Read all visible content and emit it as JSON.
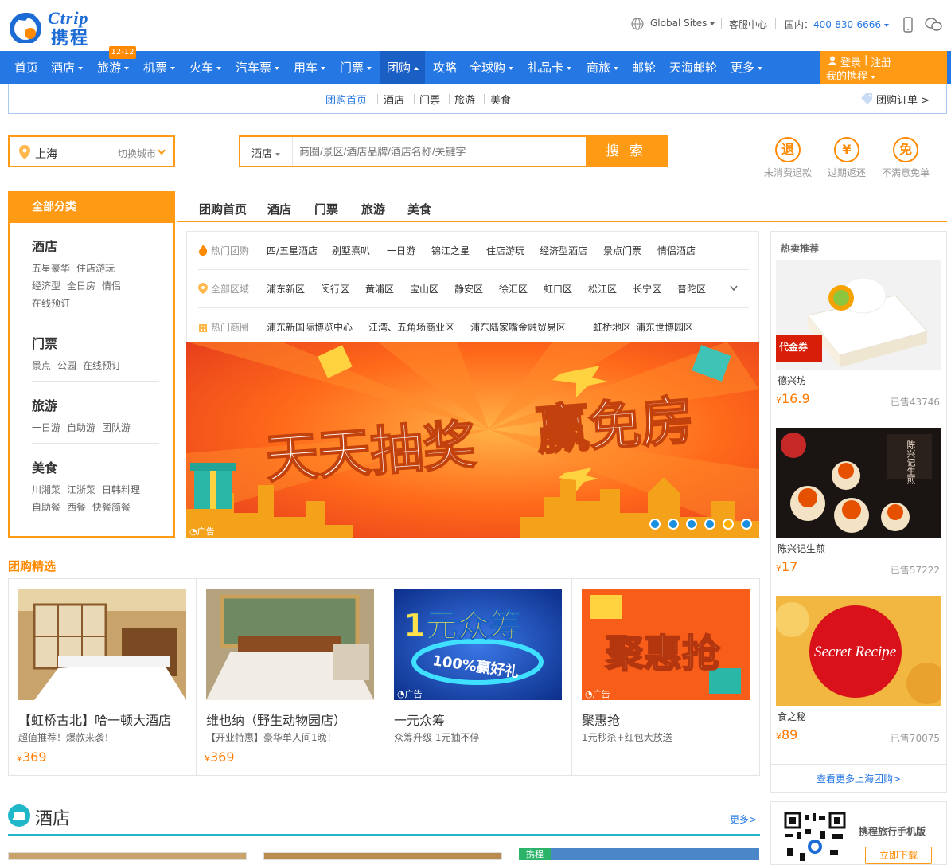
{
  "brand": {
    "latin": "Ctrip",
    "cn": "携程"
  },
  "topbar": {
    "global_sites": "Global Sites",
    "service": "客服中心",
    "phone_label": "国内：",
    "phone": "400-830-6666"
  },
  "nav": {
    "items": [
      "首页",
      "酒店",
      "旅游",
      "机票",
      "火车",
      "汽车票",
      "用车",
      "门票",
      "团购",
      "攻略",
      "全球购",
      "礼品卡",
      "商旅",
      "邮轮",
      "天海邮轮",
      "更多"
    ],
    "badge": "12-12",
    "login": "登录",
    "register": "注册",
    "my": "我的携程"
  },
  "subnav": {
    "items": [
      "团购首页",
      "酒店",
      "门票",
      "旅游",
      "美食"
    ],
    "orders": "团购订单 >"
  },
  "search": {
    "city": "上海",
    "switch_city": "切换城市",
    "type": "酒店",
    "placeholder": "商圈/景区/酒店品牌/酒店名称/关键字",
    "button": "搜 索"
  },
  "promises": [
    {
      "icon": "退",
      "label": "未消费退款"
    },
    {
      "icon": "¥",
      "label": "过期返还"
    },
    {
      "icon": "免",
      "label": "不满意免单"
    }
  ],
  "categories": {
    "head": "全部分类",
    "groups": [
      {
        "title": "酒店",
        "links": [
          "五星豪华",
          "住店游玩",
          "经济型",
          "全日房",
          "情侣",
          "在线预订"
        ]
      },
      {
        "title": "门票",
        "links": [
          "景点",
          "公园",
          "在线预订"
        ]
      },
      {
        "title": "旅游",
        "links": [
          "一日游",
          "自助游",
          "团队游"
        ]
      },
      {
        "title": "美食",
        "links": [
          "川湘菜",
          "江浙菜",
          "日韩料理",
          "自助餐",
          "西餐",
          "快餐简餐"
        ]
      }
    ]
  },
  "tabs": [
    "团购首页",
    "酒店",
    "门票",
    "旅游",
    "美食"
  ],
  "filters": {
    "hot_label": "热门团购",
    "hot": [
      "四/五星酒店",
      "别墅熹叭",
      "一日游",
      "锦江之星",
      "住店游玩",
      "经济型酒店",
      "景点门票",
      "情侣酒店"
    ],
    "area_label": "全部区域",
    "areas": [
      "浦东新区",
      "闵行区",
      "黄浦区",
      "宝山区",
      "静安区",
      "徐汇区",
      "虹口区",
      "松江区",
      "长宁区",
      "普陀区"
    ],
    "biz_label": "热门商圈",
    "biz": [
      "浦东新国际博览中心",
      "江湾、五角场商业区",
      "浦东陆家嘴金融贸易区",
      "虹桥地区",
      "浦东世博园区"
    ]
  },
  "banner": {
    "text1": "天天抽奖",
    "text2": "赢免房",
    "ad": "广告"
  },
  "hot": {
    "title": "热卖推荐",
    "items": [
      {
        "name": "德兴坊",
        "price": "16.9",
        "sold": "已售43746",
        "tag": "代金券"
      },
      {
        "name": "陈兴记生煎",
        "price": "17",
        "sold": "已售57222",
        "tag": "陈兴记生煎"
      },
      {
        "name": "食之秘",
        "price": "89",
        "sold": "已售70075",
        "tag": "Secret Recipe"
      }
    ],
    "more": "查看更多上海团购>"
  },
  "featured": {
    "title": "团购精选",
    "items": [
      {
        "title": "【虹桥古北】哈一顿大酒店",
        "desc": "超值推荐！爆款来袭！",
        "price": "369"
      },
      {
        "title": "维也纳（野生动物园店）",
        "desc": "【开业特惠】豪华单人间1晚！",
        "price": "369"
      },
      {
        "title": "一元众筹",
        "desc": "众筹升级 1元抽不停",
        "price": "",
        "art1": "1元众筹",
        "art2": "100%赢好礼"
      },
      {
        "title": "聚惠抢",
        "desc": "1元秒杀+红包大放送",
        "price": "",
        "art1": "聚惠抢"
      }
    ],
    "currency": "¥",
    "ad": "广告"
  },
  "hotel_section": {
    "title": "酒店",
    "more": "更多>",
    "tag": "携程"
  },
  "app": {
    "title": "携程旅行手机版",
    "button": "立即下载"
  },
  "colors": {
    "nav": "#2577e3",
    "orange": "#ff9a14",
    "price": "#ff7a00",
    "teal": "#20b8c8"
  }
}
